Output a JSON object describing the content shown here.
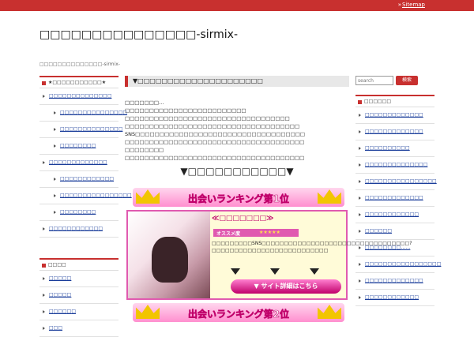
{
  "header": {
    "sitemap": "Sitemap",
    "title": "□□□□□□□□□□□□□□□-sirmix-",
    "description": "□□□□□□□□□□□□□□-sirmix-"
  },
  "left_sidebar": {
    "widget1_title": "★□□□□□□□□□□□★",
    "items": [
      {
        "label": "□□□□□□□□□□□□□□",
        "sub": false
      },
      {
        "label": "□□□□□□□□□□□□□□□",
        "sub": true
      },
      {
        "label": "□□□□□□□□□□□□□□",
        "sub": true
      },
      {
        "label": "□□□□□□□□",
        "sub": true
      },
      {
        "label": "□□□□□□□□□□□□□",
        "sub": false
      },
      {
        "label": "□□□□□□□□□□□□",
        "sub": true
      },
      {
        "label": "□□□□□□□□□□□□□□□□",
        "sub": true
      },
      {
        "label": "□□□□□□□□",
        "sub": true
      },
      {
        "label": "□□□□□□□□□□□□",
        "sub": false
      }
    ],
    "widget2_title": "□□□□",
    "items2": [
      "□□□□□",
      "□□□□□",
      "□□□□□□",
      "□□□"
    ]
  },
  "main": {
    "heading": "▼□□□□□□□□□□□□□□□□□□□□□",
    "lines": [
      "□□□□□□□…",
      "□□□□□□□□□□□□□□□□□□□□□□□□□",
      "□□□□□□□□□□□□□□□□□□□□□□□□□□□□□□□□□□",
      "□□□□□□□□□□□□□□□□□□□□□□□□□□□□□□□□□□□□",
      "SNS□□□□□□□□□□□□□□□□□□□□□□□□□□□□□□□□□□□",
      "□□□□□□□□□□□□□□□□□□□□□□□□□□□□□□□□□□□□□",
      "□□□□□□□□",
      "□□□□□□□□□□□□□□□□□□□□□□□□□□□□□□□□□□□□□"
    ],
    "ranking_heading": "▼□□□□□□□□□□□▼",
    "banner1": "出会いランキング第1位",
    "card_title": "≪□□□□□□□≫",
    "rec_label": "オススメ度",
    "rec_stars": "★★★★★",
    "desc": "□□□□□□□□□SNS□□□□□□□□□□□□□□□□□□□□□□□□□□□□□□□□□?□□□□□□□□□□□□□□□□□□□□□□□□□□",
    "cta": "▼ サイト詳細はこちら",
    "banner2": "出会いランキング第2位"
  },
  "right_sidebar": {
    "search_placeholder": "search",
    "search_button": "検索",
    "widget_title": "□□□□□□",
    "items": [
      "□□□□□□□□□□□□□",
      "□□□□□□□□□□□□□",
      "□□□□□□□□□□",
      "□□□□□□□□□□□□□□",
      "□□□□□□□□□□□□□□□□",
      "□□□□□□□□□□□□□",
      "□□□□□□□□□□□□",
      "□□□□□□",
      "□□□□□□□□……",
      "□□□□□□□□□□□□□□□□□",
      "□□□□□□□□□□□□□",
      "□□□□□□□□□□□□"
    ]
  },
  "colors": {
    "accent": "#c8302f",
    "pink": "#e05ab0"
  }
}
